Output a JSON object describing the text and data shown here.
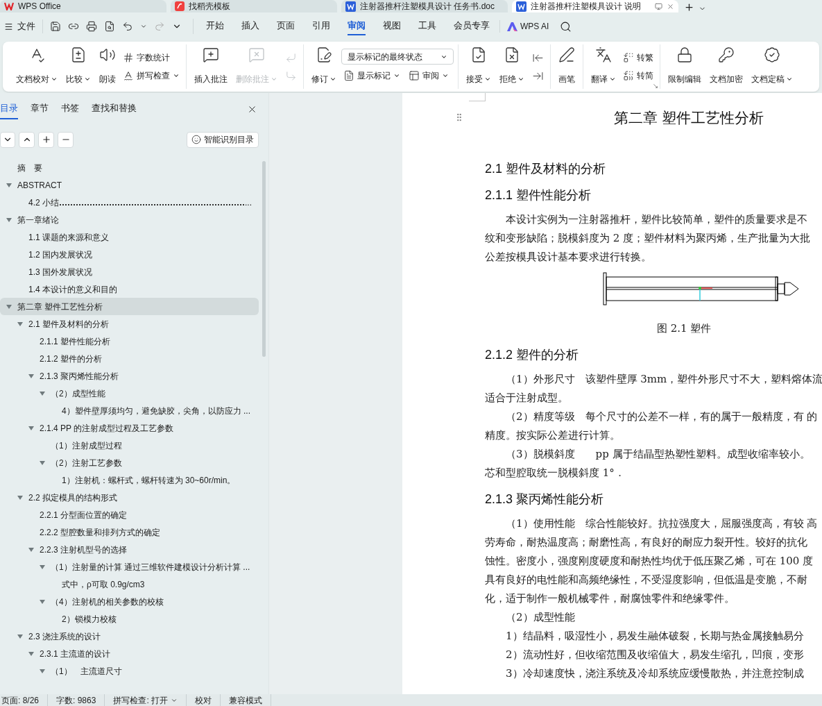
{
  "window_tabs": [
    {
      "kind": "home",
      "label": "WPS Office",
      "selected": false
    },
    {
      "kind": "template",
      "label": "找稻壳模板",
      "selected": false
    },
    {
      "kind": "doc",
      "label": "注射器推杆注塑模具设计 任务书.doc",
      "selected": false
    },
    {
      "kind": "doc",
      "label": "注射器推杆注塑模具设计 说明",
      "selected": true
    }
  ],
  "menu": {
    "file": "文件",
    "tabs": [
      {
        "label": "开始",
        "selected": false
      },
      {
        "label": "插入",
        "selected": false
      },
      {
        "label": "页面",
        "selected": false
      },
      {
        "label": "引用",
        "selected": false
      },
      {
        "label": "审阅",
        "selected": true
      },
      {
        "label": "视图",
        "selected": false
      },
      {
        "label": "工具",
        "selected": false
      },
      {
        "label": "会员专享",
        "selected": false
      }
    ],
    "ai": "WPS AI"
  },
  "ribbon": [
    {
      "columns": [
        [
          [
            {
              "kind": "large",
              "label": "文档校对",
              "dropdown": true,
              "disabled": false
            }
          ]
        ],
        [
          [
            {
              "kind": "large",
              "label": "比较",
              "dropdown": true,
              "disabled": false
            }
          ]
        ],
        [
          [
            {
              "kind": "large",
              "label": "朗读",
              "dropdown": false,
              "disabled": false
            }
          ]
        ],
        [
          [
            {
              "kind": "small",
              "label": "字数统计",
              "dropdown": false,
              "disabled": false
            }
          ],
          [
            {
              "kind": "small",
              "label": "拼写检查",
              "dropdown": true,
              "disabled": false
            }
          ]
        ]
      ]
    },
    {
      "columns": [
        [
          [
            {
              "kind": "large",
              "label": "插入批注",
              "dropdown": false,
              "disabled": false
            }
          ]
        ],
        [
          [
            {
              "kind": "large",
              "label": "删除批注",
              "dropdown": true,
              "disabled": true
            }
          ]
        ],
        [
          [
            {
              "kind": "icon",
              "disabled": true
            }
          ],
          [
            {
              "kind": "icon",
              "disabled": true
            }
          ]
        ]
      ]
    },
    {
      "columns": [
        [
          [
            {
              "kind": "large",
              "label": "修订",
              "dropdown": true,
              "disabled": false
            }
          ]
        ],
        [
          [
            {
              "kind": "select",
              "label": "显示标记的最终状态",
              "dropdown": true,
              "disabled": false
            }
          ],
          [
            {
              "kind": "small",
              "label": "显示标记",
              "dropdown": true,
              "disabled": false
            },
            {
              "kind": "small",
              "label": "审阅",
              "dropdown": true,
              "disabled": false
            }
          ]
        ]
      ]
    },
    {
      "columns": [
        [
          [
            {
              "kind": "large",
              "label": "接受",
              "dropdown": true,
              "disabled": false
            }
          ]
        ],
        [
          [
            {
              "kind": "large",
              "label": "拒绝",
              "dropdown": true,
              "disabled": false
            }
          ]
        ],
        [
          [
            {
              "kind": "icon",
              "disabled": false
            }
          ],
          [
            {
              "kind": "icon",
              "disabled": false
            }
          ]
        ]
      ]
    },
    {
      "columns": [
        [
          [
            {
              "kind": "large",
              "label": "画笔",
              "dropdown": false,
              "disabled": false
            }
          ]
        ]
      ]
    },
    {
      "columns": [
        [
          [
            {
              "kind": "large",
              "label": "翻译",
              "dropdown": true,
              "disabled": false
            }
          ]
        ],
        [
          [
            {
              "kind": "small",
              "label": "转繁",
              "dropdown": false,
              "disabled": false
            }
          ],
          [
            {
              "kind": "small",
              "label": "转简",
              "dropdown": false,
              "disabled": false
            }
          ]
        ]
      ],
      "launcher": true
    },
    {
      "columns": [
        [
          [
            {
              "kind": "large",
              "label": "限制编辑",
              "dropdown": false,
              "disabled": false
            }
          ]
        ],
        [
          [
            {
              "kind": "large",
              "label": "文档加密",
              "dropdown": false,
              "disabled": false
            }
          ]
        ],
        [
          [
            {
              "kind": "large",
              "label": "文档定稿",
              "dropdown": true,
              "disabled": false
            }
          ]
        ]
      ]
    }
  ],
  "nav": {
    "tabs": [
      {
        "label": "目录",
        "selected": true
      },
      {
        "label": "章节",
        "selected": false
      },
      {
        "label": "书签",
        "selected": false
      },
      {
        "label": "查找和替换",
        "selected": false
      }
    ],
    "smart_button": "智能识别目录",
    "tree": [
      {
        "label": "摘　要",
        "selected": false
      },
      {
        "label": "ABSTRACT",
        "selected": false,
        "expanded": true,
        "children": [
          {
            "label": "4.2 小结",
            "tail": "...",
            "selected": false
          }
        ]
      },
      {
        "label": "第一章绪论",
        "selected": false,
        "expanded": true,
        "children": [
          {
            "label": "1.1 课题的来源和意义",
            "selected": false
          },
          {
            "label": "1.2 国内发展状况",
            "selected": false
          },
          {
            "label": "1.3 国外发展状况",
            "selected": false
          },
          {
            "label": "1.4  本设计的意义和目的",
            "selected": false
          }
        ]
      },
      {
        "label": "第二章  塑件工艺性分析",
        "selected": true,
        "expanded": true,
        "children": [
          {
            "label": "2.1 塑件及材料的分析",
            "selected": false,
            "expanded": true,
            "children": [
              {
                "label": "2.1.1 塑件性能分析",
                "selected": false
              },
              {
                "label": "2.1.2 塑件的分析",
                "selected": false
              },
              {
                "label": "2.1.3 聚丙烯性能分析",
                "selected": false,
                "expanded": true,
                "children": [
                  {
                    "label": "（2）成型性能",
                    "selected": false,
                    "expanded": true,
                    "children": [
                      {
                        "label": "4）塑件壁厚须均匀，避免缺胶，尖角，以防应力 ...",
                        "selected": false
                      }
                    ]
                  }
                ]
              },
              {
                "label": "2.1.4 PP 的注射成型过程及工艺参数",
                "selected": false,
                "expanded": true,
                "children": [
                  {
                    "label": "（1）注射成型过程",
                    "selected": false
                  },
                  {
                    "label": "（2）注射工艺参数",
                    "selected": false,
                    "expanded": true,
                    "children": [
                      {
                        "label": "1）注射机：螺杆式，螺杆转速为 30~60r/min。",
                        "selected": false
                      }
                    ]
                  }
                ]
              }
            ]
          },
          {
            "label": "2.2 拟定模具的结构形式",
            "selected": false,
            "expanded": true,
            "children": [
              {
                "label": "2.2.1 分型面位置的确定",
                "selected": false
              },
              {
                "label": "2.2.2 型腔数量和排列方式的确定",
                "selected": false
              },
              {
                "label": "2.2.3 注射机型号的选择",
                "selected": false,
                "expanded": true,
                "children": [
                  {
                    "label": "（1）注射量的计算 通过三维软件建模设计分析计算 ...",
                    "selected": false,
                    "expanded": true,
                    "children": [
                      {
                        "label": "式中，ρ可取 0.9g/cm3",
                        "selected": false
                      }
                    ]
                  },
                  {
                    "label": " （4）注射机的相关参数的校核",
                    "selected": false,
                    "expanded": true,
                    "children": [
                      {
                        "label": "2）锁模力校核",
                        "selected": false
                      }
                    ]
                  }
                ]
              }
            ]
          },
          {
            "label": "2.3 浇注系统的设计",
            "selected": false,
            "expanded": true,
            "children": [
              {
                "label": "2.3.1 主流道的设计",
                "selected": false,
                "expanded": true,
                "children": [
                  {
                    "label": "（1）　主流道尺寸",
                    "selected": false,
                    "expanded": true
                  }
                ]
              }
            ]
          }
        ]
      }
    ]
  },
  "document": [
    {
      "kind": "h1",
      "text": "第二章  塑件工艺性分析"
    },
    {
      "kind": "h2",
      "text": "2.1 塑件及材料的分析"
    },
    {
      "kind": "h2",
      "text": "2.1.1 塑件性能分析"
    },
    {
      "kind": "first",
      "text": "本设计实例为一注射器推杆，塑件比较简单，塑件的质量要求是不"
    },
    {
      "kind": "line",
      "text": "纹和变形缺陷；脱模斜度为 2 度；塑件材料为聚丙烯，生产批量为大批"
    },
    {
      "kind": "line",
      "text": "公差按模具设计基本要求进行转换。"
    },
    {
      "kind": "figure"
    },
    {
      "kind": "caption",
      "text": "图 2.1 塑件"
    },
    {
      "kind": "h2",
      "text": "2.1.2 塑件的分析"
    },
    {
      "kind": "first",
      "text": "（1）外形尺寸　该塑件壁厚 3mm，塑件外形尺寸不大，塑料熔体流"
    },
    {
      "kind": "line",
      "text": "适合于注射成型。"
    },
    {
      "kind": "first",
      "text": "（2）精度等级　每个尺寸的公差不一样，有的属于一般精度，有 的"
    },
    {
      "kind": "line",
      "text": "精度。按实际公差进行计算。"
    },
    {
      "kind": "first",
      "text": "（3）脱模斜度　　pp 属于结晶型热塑性塑料。成型收缩率较小。"
    },
    {
      "kind": "line",
      "text": "芯和型腔取统一脱模斜度 1°．"
    },
    {
      "kind": "h2",
      "text": "2.1.3 聚丙烯性能分析"
    },
    {
      "kind": "first",
      "text": "（1）使用性能　综合性能较好。抗拉强度大，屈服强度高，有较 高"
    },
    {
      "kind": "line",
      "text": "劳寿命，耐热温度高；耐磨性高，有良好的耐应力裂开性。较好的抗化"
    },
    {
      "kind": "line",
      "text": "蚀性。密度小，强度刚度硬度和耐热性均优于低压聚乙烯，可在 100 度"
    },
    {
      "kind": "line",
      "text": "具有良好的电性能和高频绝缘性，不受湿度影响，但低温是变脆，不耐"
    },
    {
      "kind": "line",
      "text": "化，适于制作一般机械零件，耐腐蚀零件和绝缘零件。"
    },
    {
      "kind": "first",
      "text": "（2）成型性能"
    },
    {
      "kind": "first",
      "text": "1）结晶料，吸湿性小，易发生融体破裂，长期与热金属接触易分"
    },
    {
      "kind": "first",
      "text": "2）流动性好，但收缩范围及收缩值大，易发生缩孔，凹痕，变形"
    },
    {
      "kind": "first",
      "text": "3）冷却速度快，浇注系统及冷却系统应缓慢散热，并注意控制成"
    }
  ],
  "status_bar": [
    {
      "kind": "text",
      "label": "页面: 8/26"
    },
    {
      "kind": "text",
      "label": "字数: 9863"
    },
    {
      "kind": "menu",
      "label": "拼写检查: 打开"
    },
    {
      "kind": "text",
      "label": "校对"
    },
    {
      "kind": "text",
      "label": "兼容模式"
    }
  ]
}
